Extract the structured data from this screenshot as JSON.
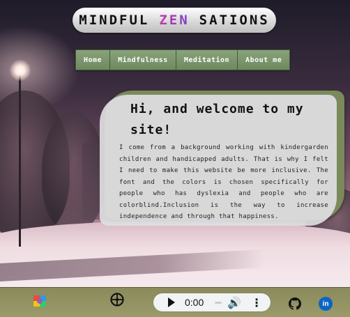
{
  "header": {
    "title_left": "MINDFUL",
    "title_middle": "ZEN",
    "title_right": "SATIONS"
  },
  "nav": {
    "items": [
      {
        "label": "Home"
      },
      {
        "label": "Mindfulness"
      },
      {
        "label": "Meditation"
      },
      {
        "label": "About me"
      }
    ]
  },
  "welcome": {
    "heading_line1": "Hi, and welcome to my",
    "heading_line2": "site!",
    "body": "I come from a background working with kindergarden children and handicapped adults. That is why I felt I need to make this website be more inclusive. The font and the colors is chosen specifically for people who has dyslexia and people who are colorblind.Inclusion is the way to increase independence and through that happiness."
  },
  "footer": {
    "audio_time": "0:00",
    "icons": [
      "colorful-app-icon",
      "wheel-icon",
      "github-icon",
      "linkedin-icon"
    ],
    "linkedin_text": "in"
  },
  "colors": {
    "nav_green": "#7a9468",
    "card_accent": "#7a8a5a",
    "footer": "#8f8f60",
    "zen_gradient_start": "#c23aa3",
    "zen_gradient_end": "#7b3fd1"
  }
}
